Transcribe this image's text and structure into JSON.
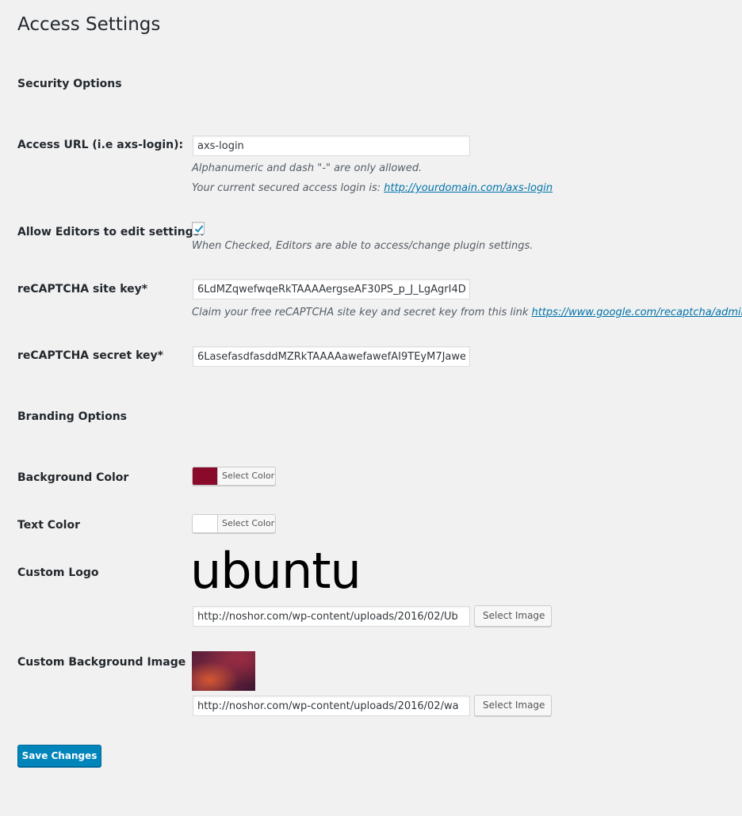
{
  "page": {
    "title": "Access Settings"
  },
  "security": {
    "section_title": "Security Options",
    "access_url": {
      "label": "Access URL (i.e axs-login):",
      "value": "axs-login",
      "help": "Alphanumeric and dash \"-\" are only allowed.",
      "current_prefix": "Your current secured access login is: ",
      "current_link": "http://yourdomain.com/axs-login"
    },
    "allow_editors": {
      "label": "Allow Editors to edit settings:",
      "checked": true,
      "help": "When Checked, Editors are able to access/change plugin settings."
    },
    "site_key": {
      "label": "reCAPTCHA site key*",
      "value": "6LdMZqwefwqeRkTAAAAergseAF30PS_p_J_LgAgrI4D",
      "help_prefix": "Claim your free reCAPTCHA site key and secret key from this link ",
      "help_link": "https://www.google.com/recaptcha/admin"
    },
    "secret_key": {
      "label": "reCAPTCHA secret key*",
      "value": "6LasefasdfasddMZRkTAAAAawefawefAI9TEyM7Jawe"
    }
  },
  "branding": {
    "section_title": "Branding Options",
    "background_color": {
      "label": "Background Color",
      "color": "#8a0a2b",
      "button_label": "Select Color"
    },
    "text_color": {
      "label": "Text Color",
      "color": "#ffffff",
      "button_label": "Select Color"
    },
    "custom_logo": {
      "label": "Custom Logo",
      "preview_text": "ubuntu",
      "url": "http://noshor.com/wp-content/uploads/2016/02/Ub",
      "button_label": "Select Image"
    },
    "custom_background": {
      "label": "Custom Background Image",
      "url": "http://noshor.com/wp-content/uploads/2016/02/wa",
      "button_label": "Select Image"
    }
  },
  "actions": {
    "save_label": "Save Changes"
  },
  "colors": {
    "page_background": "#f1f1f1",
    "link": "#0073aa",
    "primary_button": "#0085ba"
  }
}
